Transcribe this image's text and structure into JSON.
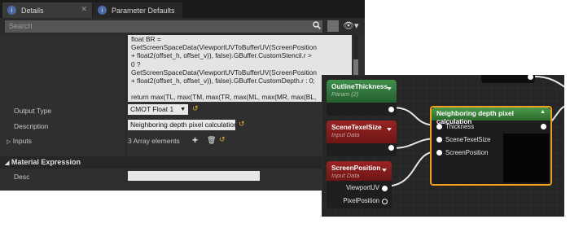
{
  "tabs": [
    {
      "label": "Details",
      "icon": "info-icon"
    },
    {
      "label": "Parameter Defaults",
      "icon": "info-icon"
    }
  ],
  "search": {
    "placeholder": "Search"
  },
  "code_text": "float BR =\nGetScreenSpaceData(ViewportUVToBufferUV(ScreenPosition\n+ float2(offset_h, offset_v)), false).GBuffer.CustomStencil.r >\n0 ?\nGetScreenSpaceData(ViewportUVToBufferUV(ScreenPosition\n+ float2(offset_h, offset_v)), false).GBuffer.CustomDepth.r : 0;\n\nreturn max(TL, max(TM, max(TR, max(ML, max(MR, max(BL,\nmax(BM, BR ) ) ) ) ) ) );",
  "properties": {
    "output_type": {
      "label": "Output Type",
      "value": "CMOT Float 1"
    },
    "description": {
      "label": "Description",
      "value": "Neighboring depth pixel calculation"
    },
    "inputs": {
      "label": "Inputs",
      "value": "3 Array elements"
    }
  },
  "section": {
    "title": "Material Expression"
  },
  "desc_label": "Desc",
  "graph": {
    "custom_node": {
      "title": "Neighboring depth pixel calculation",
      "pins": [
        "Thickness",
        "SceneTexelSize",
        "ScreenPosition"
      ]
    },
    "outline_node": {
      "title": "OutlineThickness",
      "sub": "Param (2)"
    },
    "texel_node": {
      "title": "SceneTexelSize",
      "sub": "Input Data"
    },
    "screenpos_node": {
      "title": "ScreenPosition",
      "sub": "Input Data",
      "outputs": [
        "ViewportUV",
        "PixelPosition"
      ]
    }
  },
  "colors": {
    "param_green": "#2f7a3c",
    "input_red": "#8a1d1d",
    "custom_green": "#3d8a3d",
    "selection_orange": "#f0a020"
  }
}
